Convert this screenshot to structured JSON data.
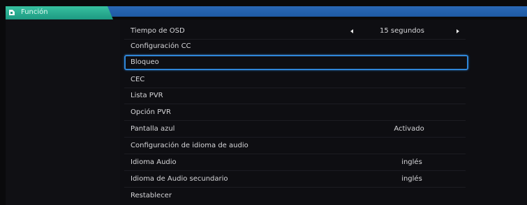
{
  "tab": {
    "label": "Función",
    "icon": "function-icon"
  },
  "colors": {
    "tab_green": "#1d9a82",
    "top_strip_blue": "#2a69b6",
    "selection_blue": "#2f86d8"
  },
  "menu": {
    "items": [
      {
        "label": "Tiempo de OSD",
        "value": "15 segundos",
        "has_arrows": true
      },
      {
        "label": "Configuración CC",
        "value": ""
      },
      {
        "label": "Bloqueo",
        "value": "",
        "selected": true
      },
      {
        "label": "CEC",
        "value": ""
      },
      {
        "label": "Lista PVR",
        "value": ""
      },
      {
        "label": "Opción PVR",
        "value": ""
      },
      {
        "label": "Pantalla azul",
        "value": "Activado"
      },
      {
        "label": "Configuración de idioma de audio",
        "value": ""
      },
      {
        "label": "Idioma Audio",
        "value": "inglés"
      },
      {
        "label": "Idioma de Audio secundario",
        "value": "inglés"
      },
      {
        "label": "Restablecer",
        "value": ""
      }
    ]
  }
}
